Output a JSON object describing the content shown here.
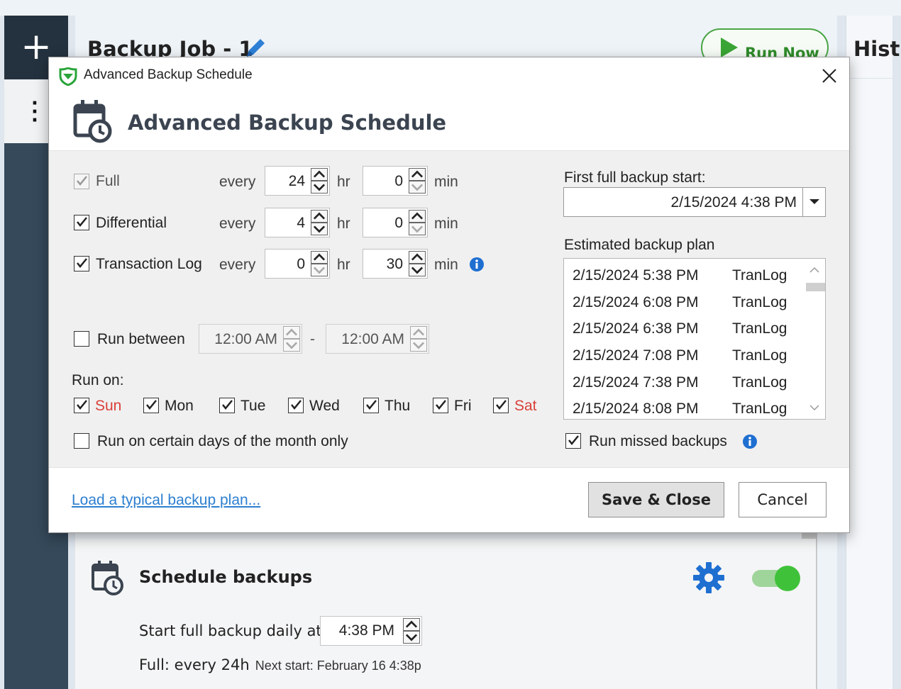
{
  "app": {
    "job_title": "Backup Job - 1",
    "run_now_label": "Run Now",
    "history_title": "Hist",
    "add_label": "+"
  },
  "dialog": {
    "window_title": "Advanced Backup Schedule",
    "header_title": "Advanced Backup Schedule",
    "rows": {
      "full": {
        "label": "Full",
        "checked": true,
        "disabled": true,
        "every": "every",
        "hours": "24",
        "hr": "hr",
        "minutes": "0",
        "min": "min"
      },
      "differential": {
        "label": "Differential",
        "checked": true,
        "every": "every",
        "hours": "4",
        "hr": "hr",
        "minutes": "0",
        "min": "min"
      },
      "tranlog": {
        "label": "Transaction Log",
        "checked": true,
        "every": "every",
        "hours": "0",
        "hr": "hr",
        "minutes": "30",
        "min": "min"
      }
    },
    "run_between": {
      "label": "Run between",
      "checked": false,
      "start": "12:00 AM",
      "dash": "-",
      "end": "12:00 AM"
    },
    "run_on_label": "Run on:",
    "days": [
      {
        "label": "Sun",
        "checked": true,
        "weekend": true
      },
      {
        "label": "Mon",
        "checked": true,
        "weekend": false
      },
      {
        "label": "Tue",
        "checked": true,
        "weekend": false
      },
      {
        "label": "Wed",
        "checked": true,
        "weekend": false
      },
      {
        "label": "Thu",
        "checked": true,
        "weekend": false
      },
      {
        "label": "Fri",
        "checked": true,
        "weekend": false
      },
      {
        "label": "Sat",
        "checked": true,
        "weekend": true
      }
    ],
    "certain_days": {
      "label": "Run on certain days of the month only",
      "checked": false
    },
    "first_full_label": "First full backup start:",
    "first_full_value": "2/15/2024 4:38 PM",
    "estimated_label": "Estimated backup plan",
    "plan": [
      {
        "time": "2/15/2024 5:38 PM",
        "type": "TranLog"
      },
      {
        "time": "2/15/2024 6:08 PM",
        "type": "TranLog"
      },
      {
        "time": "2/15/2024 6:38 PM",
        "type": "TranLog"
      },
      {
        "time": "2/15/2024 7:08 PM",
        "type": "TranLog"
      },
      {
        "time": "2/15/2024 7:38 PM",
        "type": "TranLog"
      },
      {
        "time": "2/15/2024 8:08 PM",
        "type": "TranLog"
      }
    ],
    "run_missed": {
      "label": "Run missed backups",
      "checked": true
    },
    "load_plan_link": "Load a typical backup plan...",
    "save_close": "Save & Close",
    "cancel": "Cancel"
  },
  "schedule_card": {
    "title": "Schedule backups",
    "enabled": true,
    "start_daily_label": "Start full backup daily at",
    "start_daily_value": "4:38 PM",
    "full_summary": "Full: every 24h",
    "next_start": "Next start: February 16 4:38p"
  },
  "colors": {
    "accent_green": "#3fc23a",
    "link_blue": "#2c7fd0",
    "weekend_red": "#d9403a",
    "info_blue": "#1f6fd1"
  }
}
